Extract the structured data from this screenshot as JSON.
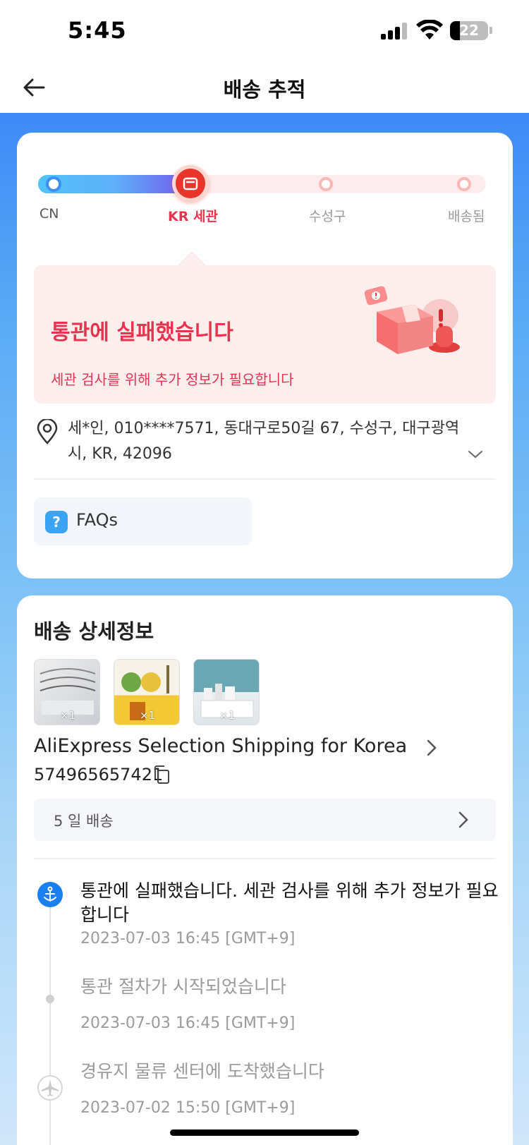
{
  "status_bar": {
    "time": "5:45",
    "battery_level": "22"
  },
  "nav": {
    "title": "배송 추적"
  },
  "progress": {
    "steps": [
      {
        "label": "CN",
        "state": "done"
      },
      {
        "label": "KR 세관",
        "state": "current"
      },
      {
        "label": "수성구",
        "state": "pending"
      },
      {
        "label": "배송됨",
        "state": "pending"
      }
    ],
    "colors": {
      "active": "#e8334f",
      "done": "#3b8ff2",
      "pending": "#f9b7b5"
    }
  },
  "alert": {
    "title": "통관에 실패했습니다",
    "subtitle": "세관 검사를 위해 추가 정보가 필요합니다"
  },
  "address": {
    "text": "세*인, 010****7571, 동대구로50길 67, 수성구, 대구광역시, KR, 42096"
  },
  "faq": {
    "label": "FAQs",
    "icon": "question-icon"
  },
  "details": {
    "title": "배송 상세정보",
    "items": [
      {
        "qty": "×1"
      },
      {
        "qty": "×1"
      },
      {
        "qty": "×1"
      }
    ],
    "carrier": "AliExpress Selection Shipping for Korea",
    "tracking_number": "574965657421",
    "eta": "5 일 배송"
  },
  "timeline": [
    {
      "title": "통관에 실패했습니다. 세관 검사를 위해 추가 정보가 필요합니다",
      "time": "2023-07-03 16:45 [GMT+9]",
      "icon": "anchor-icon"
    },
    {
      "title": "통관 절차가 시작되었습니다",
      "time": "2023-07-03 16:45 [GMT+9]",
      "icon": "dot"
    },
    {
      "title": "경유지 물류 센터에 도착했습니다",
      "time": "2023-07-02 15:50 [GMT+9]",
      "icon": "plane-icon"
    }
  ]
}
